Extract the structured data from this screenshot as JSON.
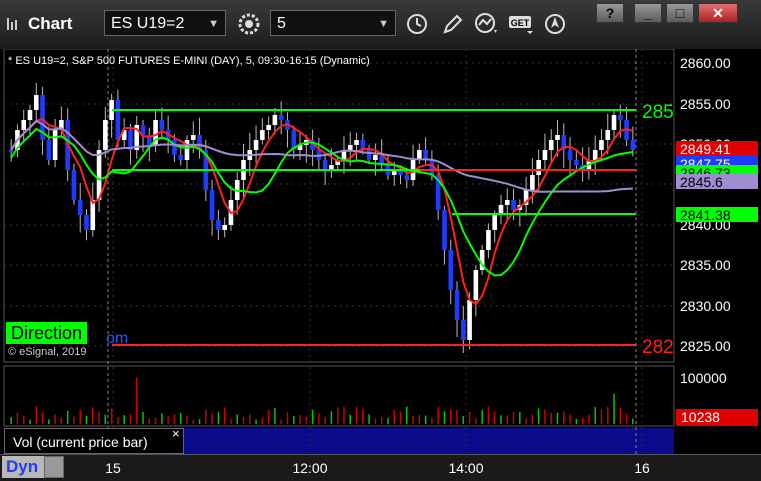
{
  "toolbar": {
    "title": "Chart",
    "symbol": "ES U19=2",
    "interval": "5",
    "buttons": {
      "minimize": "_",
      "help": "?",
      "restore": "□",
      "close": "✕"
    },
    "icons": [
      "gear-icon",
      "clock-icon",
      "pencil-icon",
      "indicator-icon",
      "get-icon",
      "navigate-icon"
    ],
    "get_label": "GET"
  },
  "chart": {
    "header": "* ES U19=2, S&P 500 FUTURES E-MINI (DAY), 5, 09:30-16:15 (Dynamic)",
    "copyright": "© eSignal, 2019",
    "direction_label": "Direction",
    "direction_tail": "om",
    "y_ticks": [
      "2860.00",
      "2855.00",
      "2850.00",
      "2845.00",
      "2840.00",
      "2835.00",
      "2830.00",
      "2825.00"
    ],
    "x_ticks": [
      "15",
      "12:00",
      "14:00",
      "16"
    ],
    "price_tags": [
      {
        "text": "2849.41",
        "bg": "#e00000",
        "fg": "#ffffff"
      },
      {
        "text": "2847.75",
        "bg": "#1e3cff",
        "fg": "#ffffff"
      },
      {
        "text": "2846.73",
        "bg": "#00ff00",
        "fg": "#000000"
      },
      {
        "text": "2845.6",
        "bg": "#a08cd0",
        "fg": "#000000"
      },
      {
        "text": "2841.38",
        "bg": "#00ff00",
        "fg": "#000000"
      }
    ],
    "level_left_labels": [
      {
        "text": "285",
        "color": "#00ff00"
      },
      {
        "text": "282",
        "color": "#ff2020"
      }
    ],
    "volume": {
      "y_ticks": [
        "100000",
        "0"
      ],
      "label": "Vol (current price bar)",
      "close": "×",
      "current_tag": "10238"
    },
    "dyn_label": "Dyn"
  },
  "colors": {
    "up": "#ffffff",
    "down": "#1e3cff",
    "green": "#00ff00",
    "red": "#ff2020",
    "purple": "#a08cd0",
    "grid": "#555555"
  }
}
